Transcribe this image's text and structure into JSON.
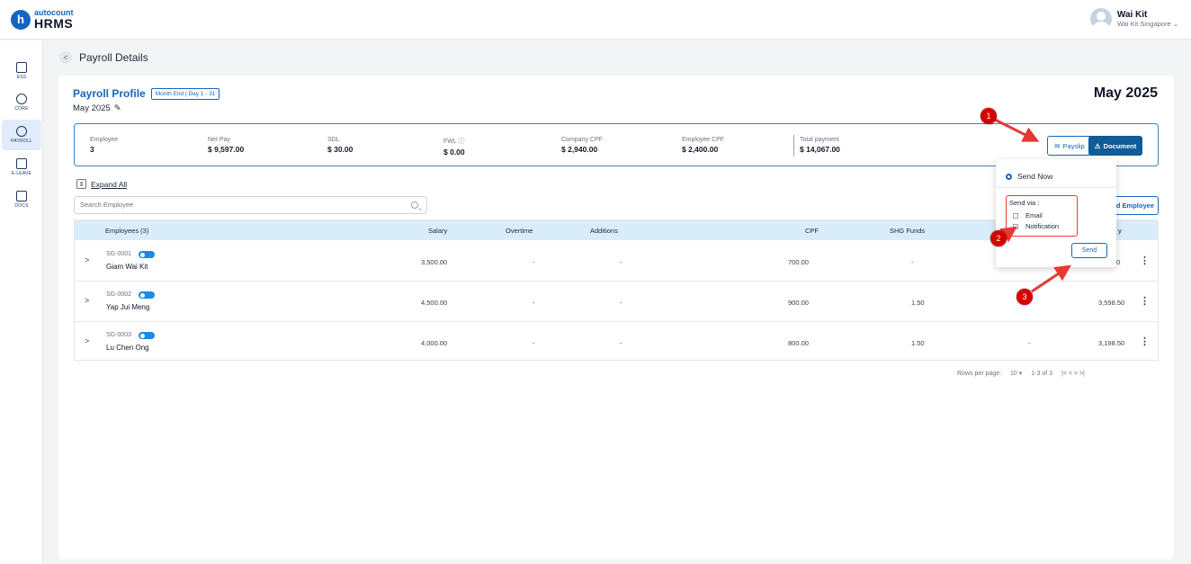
{
  "header": {
    "logo_sub": "autocount",
    "logo_main": "HRMS",
    "user_name": "Wai Kit",
    "user_company": "Wai Kit Singapore ⌄"
  },
  "sidebar": {
    "items": [
      {
        "label": "ESS",
        "icon": "ess-icon"
      },
      {
        "label": "CORE",
        "icon": "core-icon"
      },
      {
        "label": "PAYROLL",
        "icon": "payroll-icon"
      },
      {
        "label": "E-LEAVE",
        "icon": "calendar-icon"
      },
      {
        "label": "DOCS",
        "icon": "docs-icon"
      }
    ],
    "active": "PAYROLL"
  },
  "page": {
    "title": "Payroll Details",
    "profile_title": "Payroll Profile",
    "profile_badge": "Month End | Day 1 - 31",
    "month": "May 2025",
    "big_month": "May 2025"
  },
  "summary": {
    "items": [
      {
        "label": "Employee",
        "value": "3"
      },
      {
        "label": "Net Pay",
        "value": "$ 9,597.00"
      },
      {
        "label": "SDL",
        "value": "$ 30.00"
      },
      {
        "label": "FWL ⓘ",
        "value": "$ 0.00"
      },
      {
        "label": "Company CPF",
        "value": "$ 2,940.00"
      },
      {
        "label": "Employee CPF",
        "value": "$ 2,400.00"
      },
      {
        "label": "Total payment",
        "value": "$ 14,067.00"
      }
    ],
    "payslip_label": "Payslip",
    "document_label": "Document"
  },
  "toolbar": {
    "expand_all": "Expand All",
    "search_placeholder": "Search Employee",
    "add_employee": "d Employee"
  },
  "table": {
    "columns": [
      "Employees (3)",
      "Salary",
      "Overtime",
      "Additions",
      "CPF",
      "SHG Funds",
      "y"
    ],
    "rows": [
      {
        "code": "SG-0001",
        "name": "Giam Wai Kit",
        "salary": "3,500.00",
        "overtime": "-",
        "additions": "-",
        "cpf": "700.00",
        "shg": "-",
        "extra": "",
        "net": "0"
      },
      {
        "code": "SG-0002",
        "name": "Yap Jui Meng",
        "salary": "4,500.00",
        "overtime": "-",
        "additions": "-",
        "cpf": "900.00",
        "shg": "1.50",
        "extra": "",
        "net": "3,598.50"
      },
      {
        "code": "SG-0003",
        "name": "Lu Chen Ong",
        "salary": "4,000.00",
        "overtime": "-",
        "additions": "-",
        "cpf": "800.00",
        "shg": "1.50",
        "extra": "-",
        "net": "3,198.50"
      }
    ]
  },
  "pager": {
    "rows_per_page_label": "Rows per page:",
    "rows_per_page": "10 ▾",
    "range": "1-3 of 3",
    "nav": "|<   <   >   >|"
  },
  "popup": {
    "send_now": "Send Now",
    "send_via": "Send via :",
    "options": [
      "Email",
      "Notification"
    ],
    "send_button": "Send"
  },
  "markers": [
    "1",
    "2",
    "3"
  ],
  "colors": {
    "primary": "#1565c0",
    "accent_red": "#e53935",
    "marker": "#d50000",
    "table_header": "#d9ecf9"
  }
}
